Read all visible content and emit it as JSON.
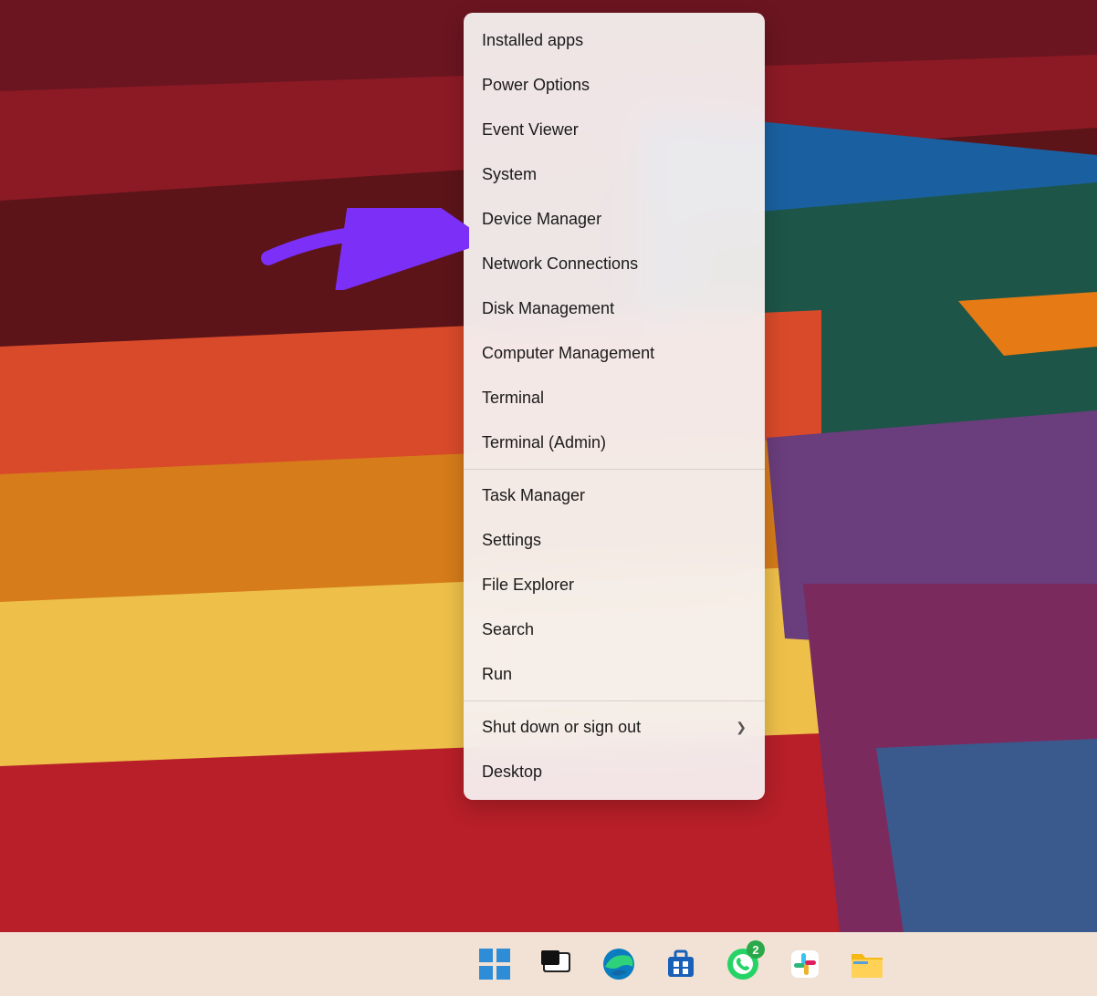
{
  "menu": {
    "groups": [
      [
        "Installed apps",
        "Power Options",
        "Event Viewer",
        "System",
        "Device Manager",
        "Network Connections",
        "Disk Management",
        "Computer Management",
        "Terminal",
        "Terminal (Admin)"
      ],
      [
        "Task Manager",
        "Settings",
        "File Explorer",
        "Search",
        "Run"
      ],
      [
        "Shut down or sign out",
        "Desktop"
      ]
    ],
    "submenu_items": [
      "Shut down or sign out"
    ]
  },
  "annotation": {
    "target": "Device Manager",
    "color": "#7B2FF7"
  },
  "taskbar": {
    "icons": [
      {
        "name": "start",
        "label": "Start"
      },
      {
        "name": "task-view",
        "label": "Task View"
      },
      {
        "name": "edge",
        "label": "Microsoft Edge"
      },
      {
        "name": "store",
        "label": "Microsoft Store"
      },
      {
        "name": "whatsapp",
        "label": "WhatsApp",
        "badge": "2"
      },
      {
        "name": "slack",
        "label": "Slack"
      },
      {
        "name": "file-explorer",
        "label": "File Explorer"
      }
    ]
  }
}
